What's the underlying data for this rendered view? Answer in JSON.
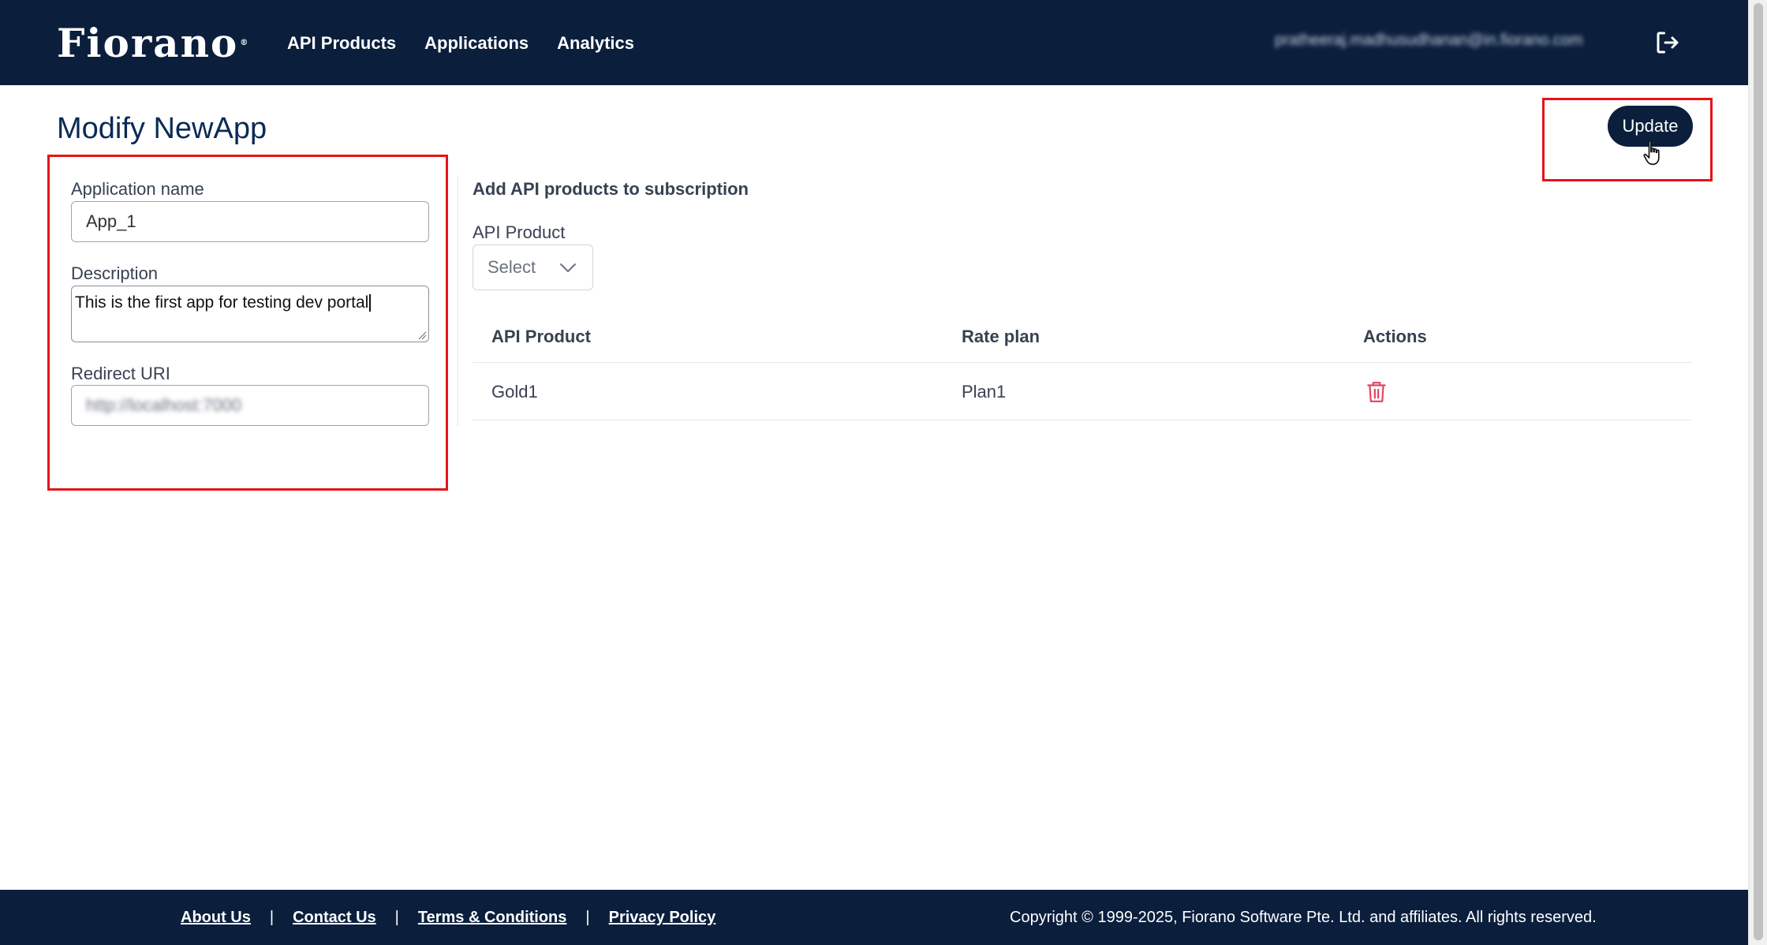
{
  "header": {
    "logo": "Fiorano",
    "logo_mark": "®",
    "nav": [
      {
        "label": "API Products"
      },
      {
        "label": "Applications"
      },
      {
        "label": "Analytics"
      }
    ],
    "user_email": "pratheeraj.madhusudhanan@in.fiorano.com",
    "logout_icon": "logout-icon"
  },
  "page": {
    "title": "Modify NewApp",
    "update_label": "Update"
  },
  "form": {
    "app_name_label": "Application name",
    "app_name_value": "App_1",
    "description_label": "Description",
    "description_value": "This is the first app for testing dev portal",
    "redirect_label": "Redirect URI",
    "redirect_value": "http://localhost:7000"
  },
  "subscription": {
    "title": "Add API products to subscription",
    "select_label": "API Product",
    "select_value": "Select",
    "table": {
      "columns": [
        "API Product",
        "Rate plan",
        "Actions"
      ],
      "rows": [
        {
          "product": "Gold1",
          "plan": "Plan1",
          "action_icon": "trash-icon"
        }
      ]
    }
  },
  "footer": {
    "links": [
      "About Us",
      "Contact Us",
      "Terms & Conditions",
      "Privacy Policy"
    ],
    "separator": "|",
    "copyright": "Copyright © 1999-2025, Fiorano Software Pte. Ltd. and affiliates. All rights reserved."
  },
  "colors": {
    "brand_navy": "#0b1f3d",
    "title_blue": "#0b2a55",
    "highlight_red": "#e5131a",
    "delete_red": "#e0435a"
  }
}
